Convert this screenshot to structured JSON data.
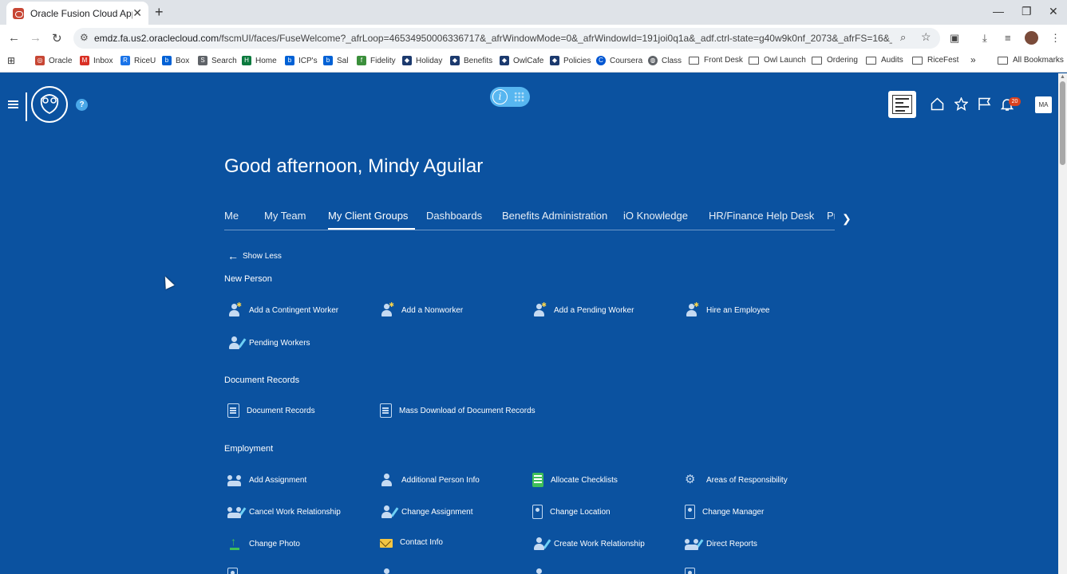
{
  "browser": {
    "tab_title": "Oracle Fusion Cloud Applications",
    "url_host": "emdz.fa.us2.oraclecloud.com",
    "url_path": "/fscmUI/faces/FuseWelcome?_afrLoop=46534950006336717&_afrWindowMode=0&_afrWindowId=191joi0q1a&_adf.ctrl-state=g40w9k0nf_2073&_afrFS=16&_afrMT=screen&_afrMF...",
    "bookmarks": [
      {
        "label": "Oracle",
        "icon": "oracle-icon",
        "color": "#c74634"
      },
      {
        "label": "Inbox",
        "icon": "gmail-icon",
        "color": "#d93025"
      },
      {
        "label": "RiceU",
        "icon": "riceu-icon",
        "color": "#1a73e8"
      },
      {
        "label": "Box",
        "icon": "box-icon",
        "color": "#0061d5"
      },
      {
        "label": "Search",
        "icon": "search-shield-icon",
        "color": "#5f6368"
      },
      {
        "label": "Home",
        "icon": "home-icon",
        "color": "#0b7a3e"
      },
      {
        "label": "ICP's",
        "icon": "box-icon",
        "color": "#0061d5"
      },
      {
        "label": "Sal",
        "icon": "box-icon",
        "color": "#0061d5"
      },
      {
        "label": "Fidelity",
        "icon": "fidelity-icon",
        "color": "#3b8f3b"
      },
      {
        "label": "Holiday",
        "icon": "owl-icon",
        "color": "#1c3a6e"
      },
      {
        "label": "Benefits",
        "icon": "owl-icon",
        "color": "#1c3a6e"
      },
      {
        "label": "OwlCafe",
        "icon": "owl-icon",
        "color": "#1c3a6e"
      },
      {
        "label": "Policies",
        "icon": "owl-icon",
        "color": "#1c3a6e"
      },
      {
        "label": "Coursera",
        "icon": "coursera-icon",
        "color": "#0056d2"
      },
      {
        "label": "Class",
        "icon": "globe-icon",
        "color": "#5f6368"
      },
      {
        "label": "Front Desk",
        "icon": "folder-icon",
        "color": "#555555"
      },
      {
        "label": "Owl Launch",
        "icon": "folder-icon",
        "color": "#555555"
      },
      {
        "label": "Ordering",
        "icon": "folder-icon",
        "color": "#555555"
      },
      {
        "label": "Audits",
        "icon": "folder-icon",
        "color": "#555555"
      },
      {
        "label": "RiceFest",
        "icon": "folder-icon",
        "color": "#555555"
      }
    ],
    "more_bookmarks": "»",
    "all_bookmarks": "All Bookmarks"
  },
  "app": {
    "greeting": "Good afternoon, Mindy Aguilar",
    "notification_count": "20",
    "avatar_initials": "MA",
    "help": "?",
    "tabs": [
      {
        "label": "Me"
      },
      {
        "label": "My Team"
      },
      {
        "label": "My Client Groups"
      },
      {
        "label": "Dashboards"
      },
      {
        "label": "Benefits Administration"
      },
      {
        "label": "iO Knowledge"
      },
      {
        "label": "HR/Finance Help Desk"
      },
      {
        "label": "Pr"
      }
    ],
    "active_tab": "My Client Groups",
    "show_less": "Show Less",
    "sections": {
      "new_person": {
        "title": "New Person",
        "items": [
          "Add a Contingent Worker",
          "Add a Nonworker",
          "Add a Pending Worker",
          "Hire an Employee",
          "Pending Workers"
        ]
      },
      "document_records": {
        "title": "Document Records",
        "items": [
          "Document Records",
          "Mass Download of Document Records"
        ]
      },
      "employment": {
        "title": "Employment",
        "items": [
          "Add Assignment",
          "Additional Person Info",
          "Allocate Checklists",
          "Areas of Responsibility",
          "Cancel Work Relationship",
          "Change Assignment",
          "Change Location",
          "Change Manager",
          "Change Photo",
          "Contact Info",
          "Create Work Relationship",
          "Direct Reports"
        ]
      }
    }
  },
  "colors": {
    "app_background": "#0b52a0",
    "accent_light": "#57b6f0",
    "badge": "#d9411e"
  }
}
